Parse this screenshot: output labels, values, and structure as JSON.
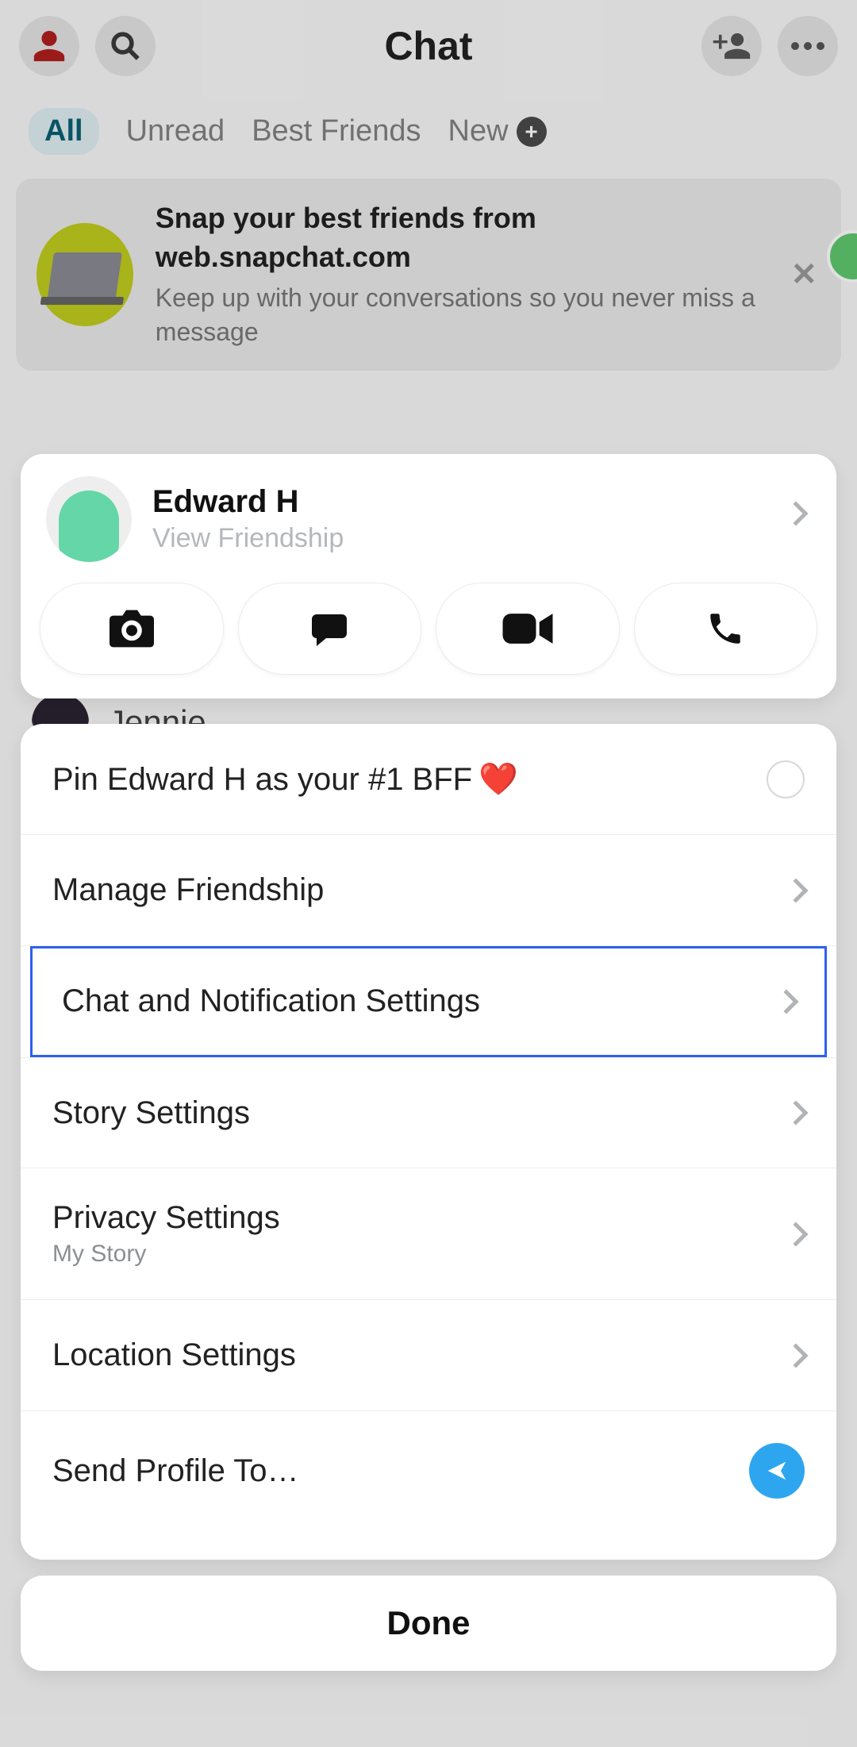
{
  "header": {
    "title": "Chat"
  },
  "tabs": {
    "all": "All",
    "unread": "Unread",
    "best_friends": "Best Friends",
    "new": "New"
  },
  "promo": {
    "title_l1": "Snap your best friends from",
    "title_l2": "web.snapchat.com",
    "subtitle": "Keep up with your conversations so you never miss a message"
  },
  "bg_contact": {
    "name": "Jennie"
  },
  "profile": {
    "name": "Edward H",
    "subtitle": "View Friendship"
  },
  "rows": {
    "pin": "Pin Edward H as your #1 BFF",
    "manage": "Manage Friendship",
    "chat_notif": "Chat and Notification Settings",
    "story": "Story Settings",
    "privacy": "Privacy Settings",
    "privacy_sub": "My Story",
    "location": "Location Settings",
    "send_profile": "Send Profile To…"
  },
  "done": "Done"
}
